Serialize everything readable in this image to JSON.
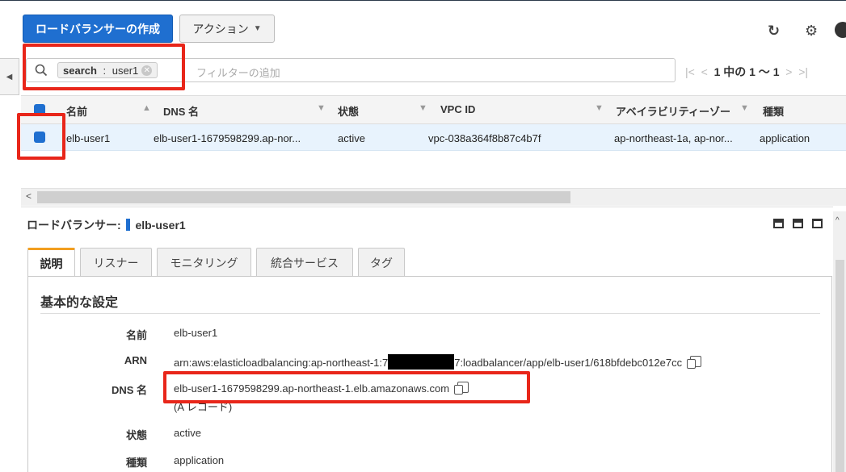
{
  "toolbar": {
    "create_label": "ロードバランサーの作成",
    "actions_label": "アクション",
    "refresh_icon": "↻",
    "settings_icon": "⚙",
    "help_icon": "❓"
  },
  "filter": {
    "chip_key": "search",
    "chip_sep": " : ",
    "chip_value": "user1",
    "placeholder": "フィルターの追加"
  },
  "pager": {
    "text": "1 中の 1 ～ 1"
  },
  "table": {
    "headers": {
      "name": "名前",
      "dns": "DNS 名",
      "state": "状態",
      "vpc": "VPC ID",
      "az": "アベイラビリティーゾー",
      "type": "種類"
    },
    "row": {
      "name": "elb-user1",
      "dns": "elb-user1-1679598299.ap-nor...",
      "state": "active",
      "vpc": "vpc-038a364f8b87c4b7f",
      "az": "ap-northeast-1a, ap-nor...",
      "type": "application"
    }
  },
  "detail": {
    "title_prefix": "ロードバランサー:",
    "title_name": "elb-user1",
    "tabs": [
      "説明",
      "リスナー",
      "モニタリング",
      "統合サービス",
      "タグ"
    ],
    "section_title": "基本的な設定",
    "fields": {
      "name_label": "名前",
      "name_value": "elb-user1",
      "arn_label": "ARN",
      "arn_prefix": "arn:aws:elasticloadbalancing:ap-northeast-1:7",
      "arn_suffix": "7:loadbalancer/app/elb-user1/618bfdebc012e7cc",
      "dns_label": "DNS 名",
      "dns_value": "elb-user1-1679598299.ap-northeast-1.elb.amazonaws.com",
      "dns_record": "(A レコード)",
      "state_label": "状態",
      "state_value": "active",
      "type_label": "種類",
      "type_value": "application"
    }
  },
  "colors": {
    "primary": "#1f6fd0",
    "highlight": "#e8261a",
    "selected_row": "#e8f3fd",
    "tab_accent": "#f29e1f"
  }
}
